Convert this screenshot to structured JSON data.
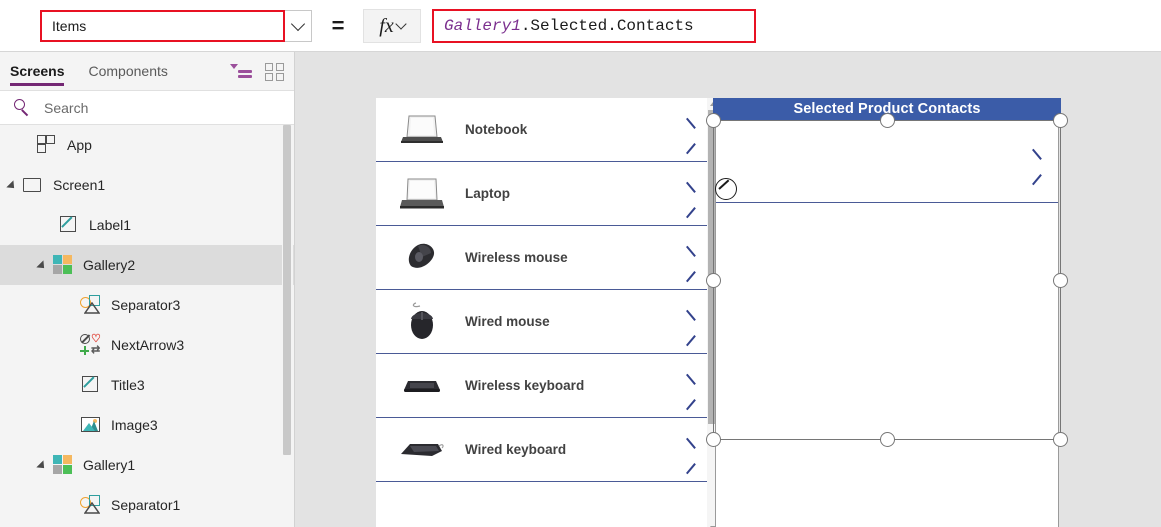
{
  "formula_bar": {
    "property_value": "Items",
    "property_caret_icon": "chevron-down-icon",
    "equals": "=",
    "fx_glyph": "fx",
    "fx_caret_icon": "chevron-down-icon",
    "formula_identifier": "Gallery1",
    "formula_rest": ".Selected.Contacts",
    "accent_error_color": "#e81123"
  },
  "tree_panel": {
    "tabs": [
      {
        "label": "Screens",
        "active": true
      },
      {
        "label": "Components",
        "active": false
      }
    ],
    "view_icons": [
      {
        "name": "tree-view-icon"
      },
      {
        "name": "thumbnail-view-icon"
      }
    ],
    "search": {
      "placeholder": "Search",
      "value": "",
      "icon": "search-icon"
    },
    "nodes": [
      {
        "label": "App",
        "icon": "app-icon",
        "indent": 0,
        "twisty": "",
        "selected": false
      },
      {
        "label": "Screen1",
        "icon": "screen-icon",
        "indent": 0,
        "twisty": "open",
        "selected": false
      },
      {
        "label": "Label1",
        "icon": "label-icon",
        "indent": 1,
        "twisty": "",
        "selected": false
      },
      {
        "label": "Gallery2",
        "icon": "gallery-icon",
        "indent": 1,
        "twisty": "open",
        "selected": true
      },
      {
        "label": "Separator3",
        "icon": "shapes-icon",
        "indent": 2,
        "twisty": "",
        "selected": false
      },
      {
        "label": "NextArrow3",
        "icon": "icons-icon",
        "indent": 2,
        "twisty": "",
        "selected": false
      },
      {
        "label": "Title3",
        "icon": "label-icon",
        "indent": 2,
        "twisty": "",
        "selected": false
      },
      {
        "label": "Image3",
        "icon": "image-icon",
        "indent": 2,
        "twisty": "",
        "selected": false
      },
      {
        "label": "Gallery1",
        "icon": "gallery-icon",
        "indent": 1,
        "twisty": "open",
        "selected": false
      },
      {
        "label": "Separator1",
        "icon": "shapes-icon",
        "indent": 2,
        "twisty": "",
        "selected": false
      }
    ],
    "selected_highlight_color": "#dcdcdc",
    "tab_accent_color": "#742774"
  },
  "canvas": {
    "background_color": "#e3e3e3",
    "gallery1": {
      "name": "Gallery1",
      "separator_color": "#4a5a96",
      "items": [
        {
          "title": "Notebook",
          "thumb": "notebook-image",
          "arrow": "next-arrow-icon"
        },
        {
          "title": "Laptop",
          "thumb": "laptop-image",
          "arrow": "next-arrow-icon"
        },
        {
          "title": "Wireless mouse",
          "thumb": "wireless-mouse-image",
          "arrow": "next-arrow-icon"
        },
        {
          "title": "Wired mouse",
          "thumb": "wired-mouse-image",
          "arrow": "next-arrow-icon"
        },
        {
          "title": "Wireless keyboard",
          "thumb": "wireless-keyboard-image",
          "arrow": "next-arrow-icon"
        },
        {
          "title": "Wired keyboard",
          "thumb": "wired-keyboard-image",
          "arrow": "next-arrow-icon"
        }
      ],
      "scrollbar": {
        "up_icon": "scroll-up-arrow-icon",
        "down_icon": "scroll-down-arrow-icon"
      }
    },
    "gallery2": {
      "name": "Gallery2",
      "header_title": "Selected Product Contacts",
      "header_color": "#3b5ca8",
      "header_text_color": "#ffffff",
      "row_arrow_icon": "next-arrow-icon",
      "edit_badge_icon": "edit-pencil-icon",
      "separator_color": "#4a5a96",
      "selected": true,
      "handles": [
        "handle-top-left",
        "handle-top-center",
        "handle-top-right",
        "handle-middle-left",
        "handle-middle-right",
        "handle-bottom-left",
        "handle-bottom-center",
        "handle-bottom-right"
      ]
    }
  }
}
